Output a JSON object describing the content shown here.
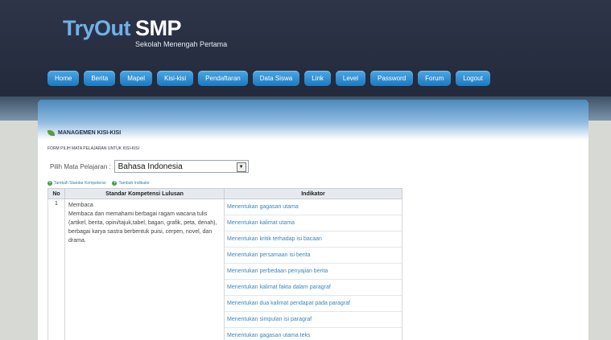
{
  "logo": {
    "brand_left": "TryOut",
    "brand_right": "SMP",
    "subtitle": "Sekolah Menengah Pertama"
  },
  "nav": [
    "Home",
    "Berita",
    "Mapel",
    "Kisi-kisi",
    "Pendaftaran",
    "Data Siswa",
    "Link",
    "Level",
    "Password",
    "Forum",
    "Logout"
  ],
  "section": {
    "title": "MANAGEMEN KISI-KISI",
    "form_caption": "FORM PILIH MATA PELAJARAN UNTUK KISI-KISI"
  },
  "form": {
    "label": "Pilih Mata Pelajaran :",
    "selected": "Bahasa Indonesia"
  },
  "actions": {
    "add_sk": "Tambah Standar Kompetensi",
    "add_indikator": "Tambah Indikator"
  },
  "table": {
    "headers": [
      "No",
      "Standar Kompetensi Lulusan",
      "Indikator"
    ],
    "row": {
      "no": "1",
      "sk_title": "Membaca",
      "sk_desc": "Membaca dan memahami berbagai ragam wacana tulis (artikel, berita, opini/tajuk,tabel, bagan, grafik, peta, denah), berbagai karya sastra berbentuk puisi, cerpen, novel, dan drama.",
      "indikator": [
        "Menentukan gagasan utama",
        "Menentukan kalimat utama",
        "Menentukan kritik terhadap isi bacaan",
        "Menentukan persamaan isi berita",
        "Menentukan perbedaan penyajian berita",
        "Menentukan kalimat fakta dalam paragraf",
        "Menentukan dua kalimat pendapat pada paragraf",
        "Menentukan simpulan isi paragraf",
        "Menentukan gagasan utama teks"
      ]
    }
  },
  "colors": {
    "header": "#2a3145",
    "nav_button": "#2a8ad4",
    "link": "#3a86c0"
  }
}
